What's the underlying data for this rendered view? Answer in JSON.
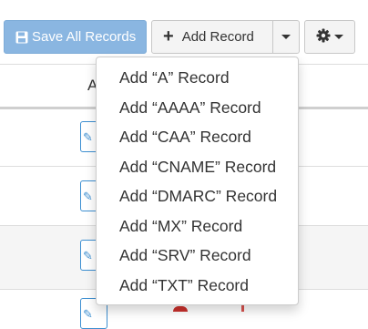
{
  "toolbar": {
    "save_label": "Save All Records",
    "add_label": "Add Record",
    "save_color": "#8ab6e1"
  },
  "table": {
    "column_header": "A"
  },
  "add_record_menu": {
    "items": [
      {
        "label": "Add “A” Record"
      },
      {
        "label": "Add “AAAA” Record"
      },
      {
        "label": "Add “CAA” Record"
      },
      {
        "label": "Add “CNAME” Record"
      },
      {
        "label": "Add “DMARC” Record"
      },
      {
        "label": "Add “MX” Record"
      },
      {
        "label": "Add “SRV” Record"
      },
      {
        "label": "Add “TXT” Record"
      }
    ]
  },
  "icons": {
    "save": "floppy-disk-icon",
    "add": "plus-icon",
    "dropdown": "caret-down-icon",
    "settings": "gear-icon"
  }
}
